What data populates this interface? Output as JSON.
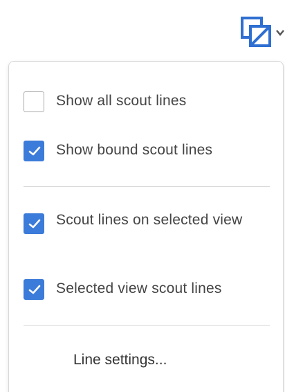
{
  "toolbar": {
    "scout_button_icon": "scout-lines-icon",
    "dropdown_icon": "chevron-down-icon",
    "accent_color": "#3b7bd9"
  },
  "menu": {
    "items": [
      {
        "label": "Show all scout lines",
        "checked": false
      },
      {
        "label": "Show bound scout lines",
        "checked": true
      },
      {
        "label": "Scout lines on selected view",
        "checked": true
      },
      {
        "label": "Selected view scout lines",
        "checked": true
      }
    ],
    "line_settings_label": "Line settings..."
  }
}
